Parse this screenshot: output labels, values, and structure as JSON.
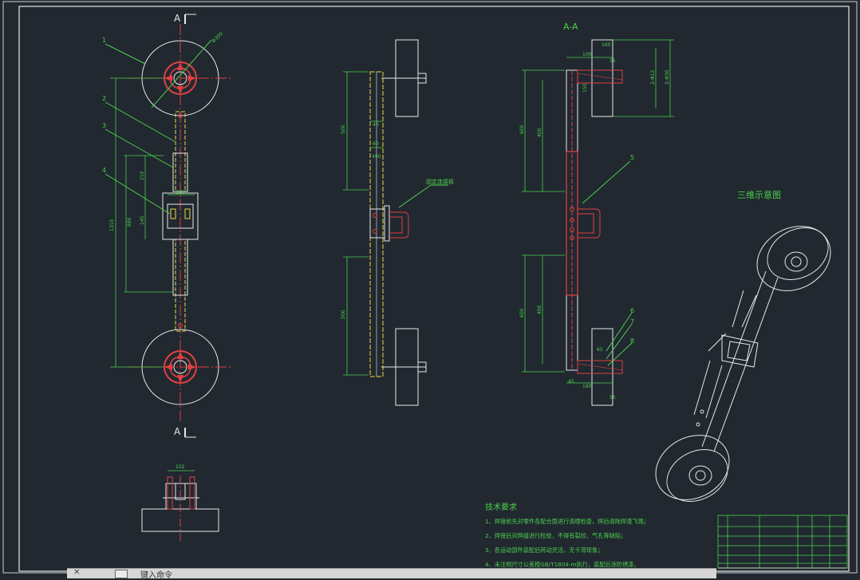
{
  "section_label": "A-A",
  "cut_marks": {
    "top": "A",
    "bottom": "A"
  },
  "view3d_title": "三维示意图",
  "handle_note": "固定连接板",
  "tech_req": {
    "title": "技术要求",
    "items": [
      "1、焊接前先对零件各配合面进行清理检查，焊后清除焊渣飞溅；",
      "2、焊接后对焊缝进行检验，不得有裂纹、气孔等缺陷；",
      "3、各运动部件装配后转动灵活，无卡滞现象；",
      "4、未注明尺寸公差按GB/T1804-m执行，装配后涂防锈漆。"
    ]
  },
  "part_numbers": [
    "1",
    "2",
    "3",
    "4",
    "5",
    "6",
    "7",
    "8"
  ],
  "dims": {
    "wheel_dia": "Φ300",
    "total_h": "1310",
    "d880": "880",
    "d210": "210",
    "d145": "145",
    "d180": "180",
    "d500": "500",
    "d500b": "500",
    "d40": "40",
    "d60": "60",
    "d490": "490",
    "d600": "600",
    "d600b": "600",
    "d400": "400",
    "d400b": "400",
    "d45": "45",
    "d180b": "180",
    "d2_phi12": "2-Φ12",
    "d2_phi30": "2-Φ30",
    "d100": "100",
    "d160": "160",
    "d55": "55",
    "d150": "150",
    "d65": "65",
    "d55b": "55",
    "d102": "102"
  },
  "command_line": {
    "prefix": "✕",
    "text": "键入命令"
  }
}
